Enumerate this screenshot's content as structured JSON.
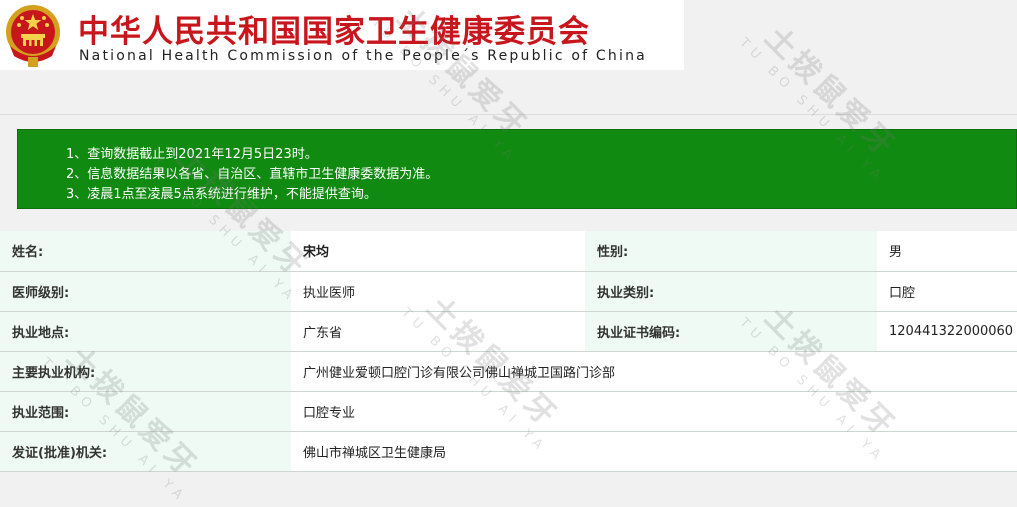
{
  "header": {
    "title_cn": "中华人民共和国国家卫生健康委员会",
    "title_en": "National Health Commission of the People´s Republic of China",
    "brand_color": "#c8161d"
  },
  "notice": {
    "background": "#118a11",
    "lines": [
      "1、查询数据截止到2021年12月5日23时。",
      "2、信息数据结果以各省、自治区、直辖市卫生健康委数据为准。",
      "3、凌晨1点至凌晨5点系统进行维护，不能提供查询。"
    ]
  },
  "record": {
    "name_label": "姓名:",
    "name_value": "宋均",
    "gender_label": "性别:",
    "gender_value": "男",
    "level_label": "医师级别:",
    "level_value": "执业医师",
    "category_label": "执业类别:",
    "category_value": "口腔",
    "location_label": "执业地点:",
    "location_value": "广东省",
    "cert_label": "执业证书编码:",
    "cert_value": "120441322000060",
    "org_label": "主要执业机构:",
    "org_value": "广州健业爱顿口腔门诊有限公司佛山禅城卫国路门诊部",
    "scope_label": "执业范围:",
    "scope_value": "口腔专业",
    "issuer_label": "发证(批准)机关:",
    "issuer_value": "佛山市禅城区卫生健康局"
  },
  "watermark": {
    "cn": "土拨鼠爱牙",
    "en": "TU BO SHU AI YA"
  }
}
